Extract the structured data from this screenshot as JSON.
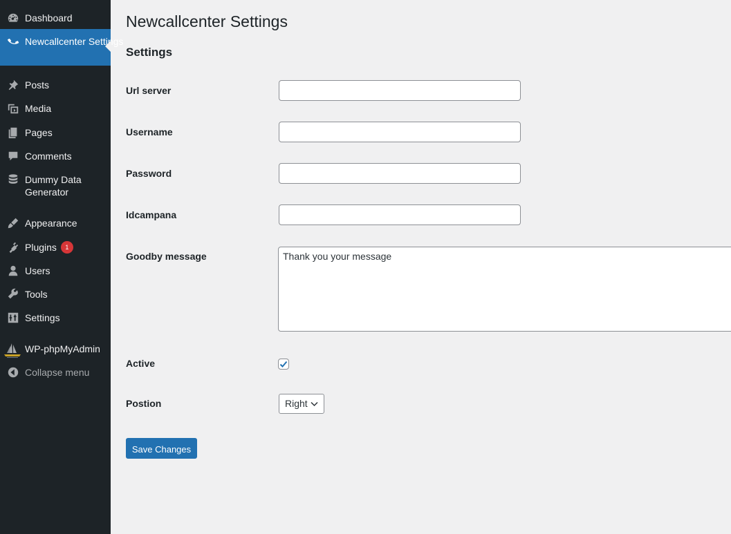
{
  "sidebar": {
    "items": [
      {
        "label": "Dashboard",
        "icon": "dashboard-icon"
      },
      {
        "label": "Newcallcenter Settings",
        "icon": "phone-icon",
        "active": true
      },
      {
        "label": "Posts",
        "icon": "pin-icon"
      },
      {
        "label": "Media",
        "icon": "media-icon"
      },
      {
        "label": "Pages",
        "icon": "pages-icon"
      },
      {
        "label": "Comments",
        "icon": "comments-icon"
      },
      {
        "label": "Dummy Data Generator",
        "icon": "database-icon"
      },
      {
        "label": "Appearance",
        "icon": "brush-icon"
      },
      {
        "label": "Plugins",
        "icon": "plugin-icon",
        "badge": "1"
      },
      {
        "label": "Users",
        "icon": "user-icon"
      },
      {
        "label": "Tools",
        "icon": "wrench-icon"
      },
      {
        "label": "Settings",
        "icon": "sliders-icon"
      },
      {
        "label": "WP-phpMyAdmin",
        "icon": "phpmyadmin-logo-icon"
      }
    ],
    "collapse_label": "Collapse menu"
  },
  "main": {
    "title": "Newcallcenter Settings",
    "section_title": "Settings",
    "fields": {
      "url_server": {
        "label": "Url server",
        "value": ""
      },
      "username": {
        "label": "Username",
        "value": ""
      },
      "password": {
        "label": "Password",
        "value": ""
      },
      "idcampana": {
        "label": "Idcampana",
        "value": ""
      },
      "goodby_message": {
        "label": "Goodby message",
        "value": "Thank you your message"
      },
      "active": {
        "label": "Active",
        "checked": true
      },
      "position": {
        "label": "Postion",
        "selected": "Right"
      }
    },
    "save_label": "Save Changes"
  },
  "colors": {
    "sidebar_bg": "#1d2327",
    "accent": "#2271b1",
    "page_bg": "#f0f0f1",
    "badge": "#d63638"
  }
}
